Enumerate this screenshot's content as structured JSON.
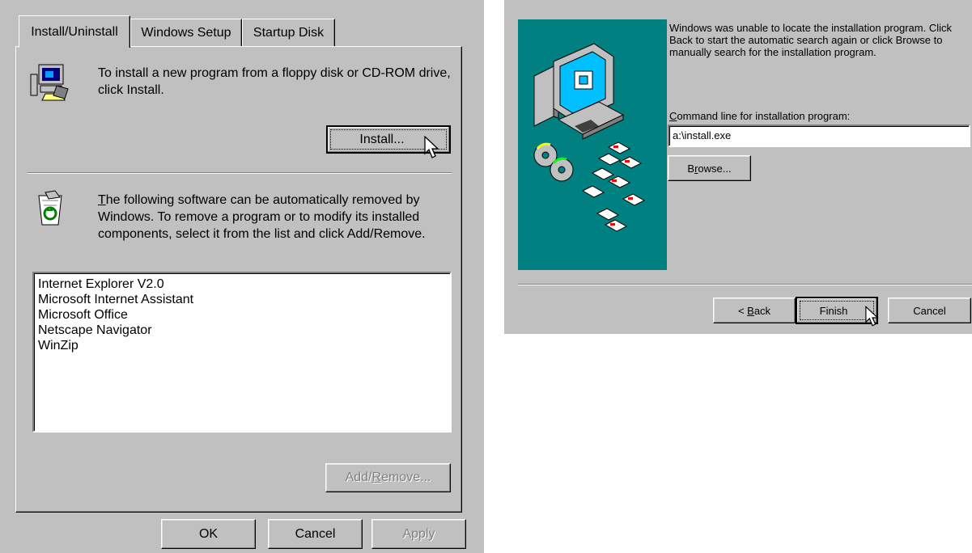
{
  "add_remove_dialog": {
    "tabs": [
      "Install/Uninstall",
      "Windows Setup",
      "Startup Disk"
    ],
    "install_text": "To install a new program from a floppy disk or CD-ROM drive, click Install.",
    "install_button": "Install...",
    "uninstall_text_lead": "T",
    "uninstall_text": "he following software can be automatically removed by Windows. To remove a program or to modify its installed components, select it from the list and click Add/Remove.",
    "programs": [
      "Internet Explorer V2.0",
      "Microsoft Internet Assistant",
      "Microsoft Office",
      "Netscape Navigator",
      "WinZip"
    ],
    "add_remove_button": {
      "pre": "Add/",
      "key": "R",
      "post": "emove..."
    },
    "ok_button": "OK",
    "cancel_button": "Cancel",
    "apply_button": "Apply",
    "icons": {
      "install": "computer-install-icon",
      "uninstall": "recycle-bin-icon"
    }
  },
  "wizard": {
    "message": "Windows was unable to locate the installation program. Click Back to start the automatic search again or click Browse to manually search for the installation program.",
    "command_label": {
      "key": "C",
      "rest": "ommand line for installation program:"
    },
    "command_value": "a:\\install.exe",
    "browse_button": {
      "pre": "B",
      "key": "r",
      "post": "owse..."
    },
    "back_button": {
      "pre": "< ",
      "key": "B",
      "post": "ack"
    },
    "finish_button": "Finish",
    "cancel_button": "Cancel",
    "colors": {
      "art_background": "#008080"
    }
  }
}
